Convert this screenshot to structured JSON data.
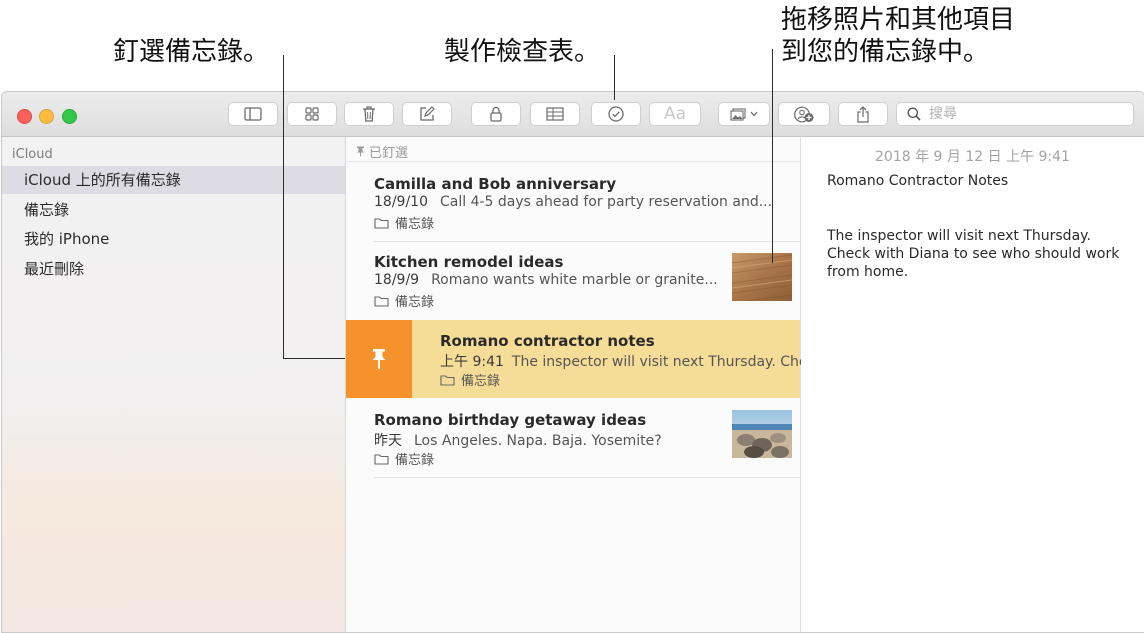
{
  "callouts": {
    "pin": "釘選備忘錄。",
    "checklist": "製作檢查表。",
    "drag_photos_line1": "拖移照片和其他項目",
    "drag_photos_line2": "到您的備忘錄中。"
  },
  "toolbar": {
    "buttons": [
      "sidebar-toggle-icon",
      "gallery-view-icon",
      "trash-icon",
      "compose-icon",
      "lock-icon",
      "table-icon",
      "checklist-icon",
      "format-text-icon",
      "media-icon",
      "collaborate-icon",
      "share-icon"
    ],
    "format_label": "Aa",
    "search_placeholder": "搜尋"
  },
  "sidebar": {
    "account": "iCloud",
    "items": [
      {
        "label": "iCloud 上的所有備忘錄",
        "selected": true
      },
      {
        "label": "備忘錄",
        "selected": false
      },
      {
        "label": "我的 iPhone",
        "selected": false
      },
      {
        "label": "最近刪除",
        "selected": false
      }
    ]
  },
  "list": {
    "pinned_header": "已釘選",
    "notes": [
      {
        "title": "Camilla and Bob anniversary",
        "date": "18/9/10",
        "snippet": "Call 4-5 days ahead for party reservation and...",
        "folder": "備忘錄"
      },
      {
        "title": "Kitchen remodel ideas",
        "date": "18/9/9",
        "snippet": "Romano wants white marble or granite...",
        "folder": "備忘錄"
      },
      {
        "title": "Romano contractor notes",
        "date": "上午 9:41",
        "snippet": "The inspector will visit next Thursday. Check",
        "folder": "備忘錄"
      },
      {
        "title": "Romano birthday getaway ideas",
        "date": "昨天",
        "snippet": "Los Angeles. Napa. Baja. Yosemite?",
        "folder": "備忘錄"
      }
    ]
  },
  "detail": {
    "date": "2018 年 9 月 12 日 上午 9:41",
    "title": "Romano Contractor Notes",
    "body": "The inspector will visit next Thursday. Check with Diana to see who should work from home."
  },
  "colors": {
    "pin_swipe": "#f6922b",
    "selected_note": "#f5dc97",
    "sidebar_selected": "#dddbe3"
  }
}
